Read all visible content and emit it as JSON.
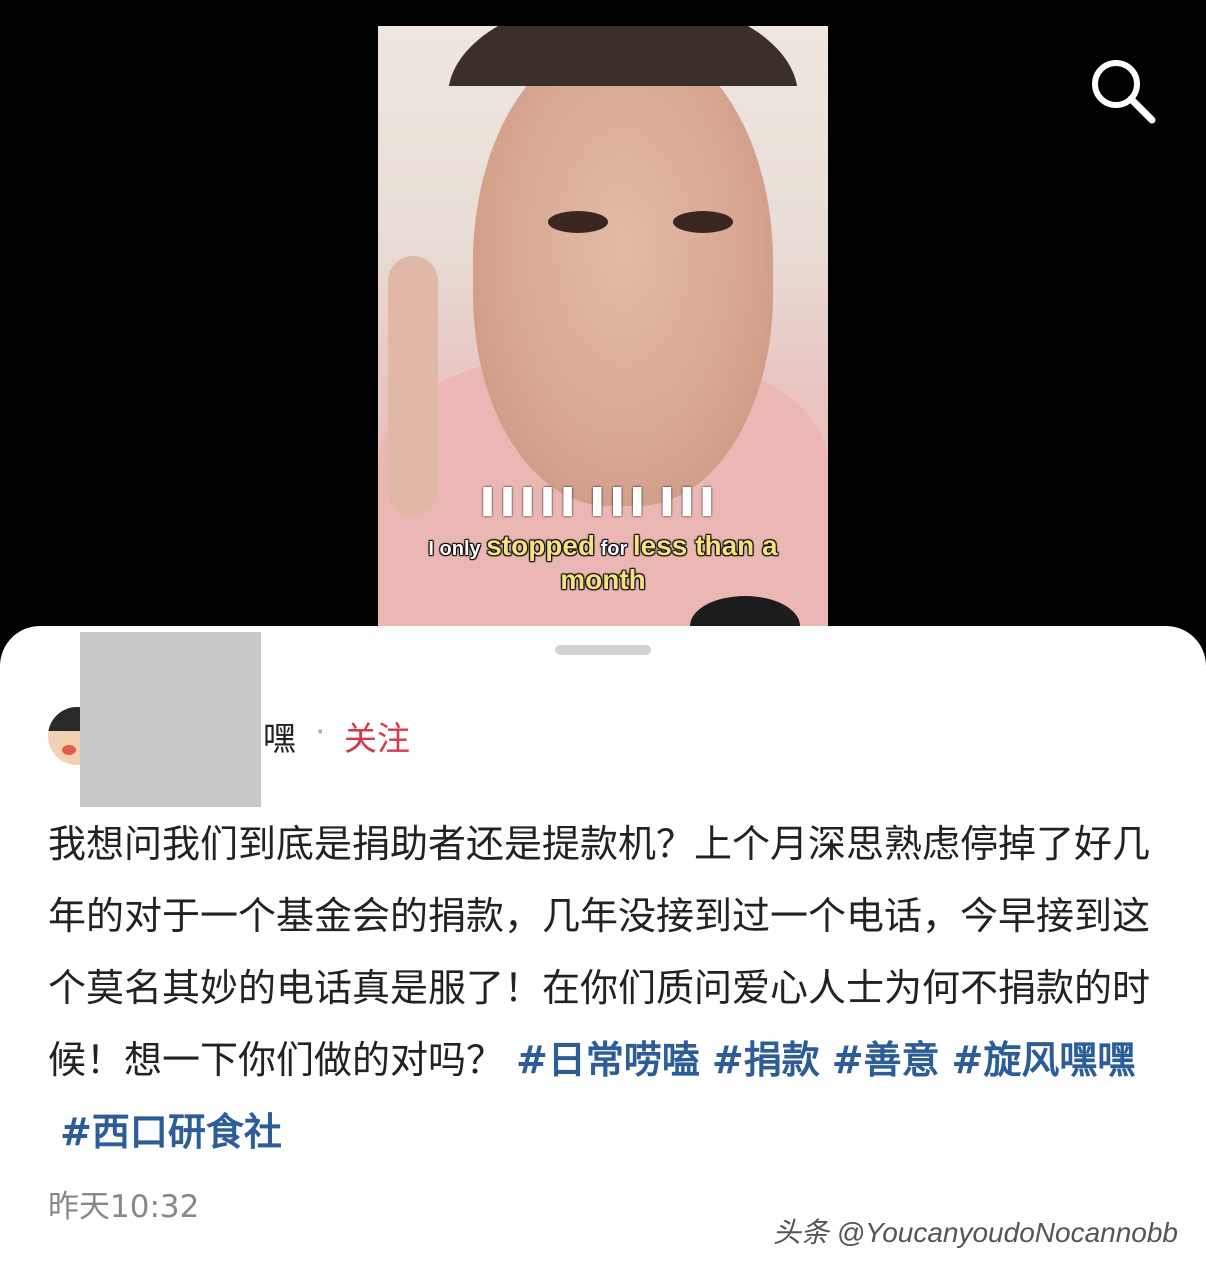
{
  "video": {
    "subtitle_hidden": "▌▌▌▌▌ ▌▌▌ ▌▌▌",
    "subtitle_words": [
      {
        "text": "I only ",
        "style": "white"
      },
      {
        "text": "stopped",
        "style": "yellow"
      },
      {
        "text": " for ",
        "style": "white"
      },
      {
        "text": "less than a",
        "style": "yellow"
      }
    ],
    "subtitle_line2": "month"
  },
  "toolbar": {
    "search_icon": "search-icon"
  },
  "post": {
    "author_suffix": "嘿",
    "separator": "·",
    "follow_label": "关注",
    "body": "我想问我们到底是捐助者还是提款机？上个月深思熟虑停掉了好几年的对于一个基金会的捐款，几年没接到过一个电话，今早接到这个莫名其妙的电话真是服了！在你们质问爱心人士为何不捐款的时候！想一下你们做的对吗？",
    "hashtags": [
      "#日常唠嗑",
      "#捐款",
      "#善意",
      "#旋风嘿嘿",
      "#西口研食社"
    ],
    "timestamp": "昨天10:32"
  },
  "watermark": "头条 @YoucanyoudoNocannobb",
  "colors": {
    "follow": "#d63a49",
    "hashtag": "#2c5d98",
    "timestamp": "#888888"
  }
}
